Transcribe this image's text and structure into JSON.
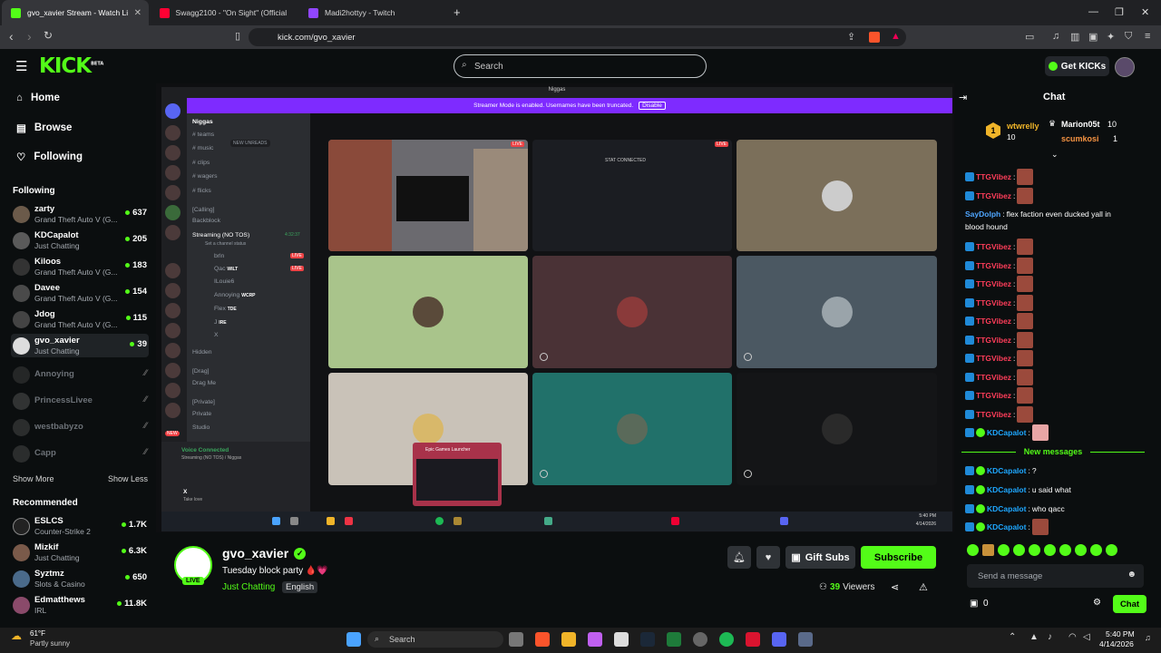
{
  "browser": {
    "tabs": [
      {
        "label": "gvo_xavier Stream - Watch Li",
        "color": "#53fc18",
        "active": true
      },
      {
        "label": "Swagg2100 - \"On Sight\" (Official Vide",
        "color": "#ff0033",
        "active": false
      },
      {
        "label": "Madi2hottyy - Twitch",
        "color": "#9146ff",
        "active": false
      }
    ],
    "new_tab": "+",
    "url": "kick.com/gvo_xavier"
  },
  "header": {
    "logo": "KICK",
    "logo_sup": "BETA",
    "search_placeholder": "Search",
    "get_kicks": "Get KICKs"
  },
  "sidebar": {
    "nav": [
      {
        "label": "Home",
        "icon": "home-icon"
      },
      {
        "label": "Browse",
        "icon": "browse-icon"
      },
      {
        "label": "Following",
        "icon": "heart-icon"
      }
    ],
    "following_title": "Following",
    "following": [
      {
        "name": "zarty",
        "sub": "Grand Theft Auto V (G...",
        "count": "637",
        "online": true
      },
      {
        "name": "KDCapalot",
        "sub": "Just Chatting",
        "count": "205",
        "online": true
      },
      {
        "name": "Kiloos",
        "sub": "Grand Theft Auto V (G...",
        "count": "183",
        "online": true
      },
      {
        "name": "Davee",
        "sub": "Grand Theft Auto V (G...",
        "count": "154",
        "online": true
      },
      {
        "name": "Jdog",
        "sub": "Grand Theft Auto V (G...",
        "count": "115",
        "online": true
      },
      {
        "name": "gvo_xavier",
        "sub": "Just Chatting",
        "count": "39",
        "online": true,
        "selected": true
      },
      {
        "name": "Annoying",
        "online": false
      },
      {
        "name": "PrincessLivee",
        "online": false
      },
      {
        "name": "westbabyzo",
        "online": false
      },
      {
        "name": "Capp",
        "online": false
      }
    ],
    "show_more": "Show More",
    "show_less": "Show Less",
    "recommended_title": "Recommended",
    "recommended": [
      {
        "name": "ESLCS",
        "sub": "Counter-Strike 2",
        "count": "1.7K"
      },
      {
        "name": "Mizkif",
        "sub": "Just Chatting",
        "count": "6.3K"
      },
      {
        "name": "Syztmz",
        "sub": "Slots & Casino",
        "count": "650"
      },
      {
        "name": "Edmatthews",
        "sub": "IRL",
        "count": "11.8K"
      }
    ]
  },
  "stream_content": {
    "window_title": "Niggas",
    "streamer_mode": "Streamer Mode is enabled. Usernames have been truncated.",
    "disable": "Disable",
    "server_name": "Niggas",
    "channels": [
      "teams",
      "music",
      "clips",
      "wagers",
      "flicks"
    ],
    "new_unreads": "NEW UNREADS",
    "calling_cat": "[Calling]",
    "backblock": "Backblock",
    "streaming_channel": "Streaming (NO TOS)",
    "streaming_time": "4:32:37",
    "set_status": "Set a channel status",
    "members": [
      {
        "name": "brln",
        "tag": "LIVE"
      },
      {
        "name": "Qac",
        "tag": "WILT"
      },
      {
        "name": "ILouie6",
        "tag": ""
      },
      {
        "name": "Annoying",
        "tag": "WCRP"
      },
      {
        "name": "Flex",
        "tag": "TDE"
      },
      {
        "name": "J",
        "tag": "IRE"
      },
      {
        "name": "X",
        "tag": ""
      }
    ],
    "hidden": "Hidden",
    "drag_cat": "[Drag]",
    "drag_me": "Drag Me",
    "private_cat": "[Private]",
    "private": "Private",
    "studio": "Studio",
    "voice_connected": "Voice Connected",
    "voice_sub": "Streaming (NO TOS) / Niggas",
    "user_x": "X",
    "user_status": "Take love",
    "popup": "Epic Games Launcher",
    "live_tag": "LIVE",
    "stream_title": "STAT CONNECTED",
    "time": "5:40 PM",
    "date": "4/14/2026",
    "new_badge": "NEW"
  },
  "channel": {
    "name": "gvo_xavier",
    "live": "LIVE",
    "title": "Tuesday block party 🩸💗",
    "category": "Just Chatting",
    "language": "English",
    "gift_subs": "Gift Subs",
    "subscribe": "Subscribe",
    "viewers_count": "39",
    "viewers_label": "Viewers"
  },
  "chat": {
    "title": "Chat",
    "leaderboard": [
      {
        "rank": "1",
        "name": "wtwrelly",
        "count": "10"
      },
      {
        "name": "Marion05t",
        "count": "10"
      },
      {
        "name": "scumkosi",
        "count": "1"
      }
    ],
    "messages": [
      {
        "user": "TTGVibez",
        "text": "",
        "style": "u1"
      },
      {
        "user": "TTGVibez",
        "text": "",
        "style": "u1"
      },
      {
        "user": "SayDolph",
        "text": "flex faction even ducked yall in",
        "text2": "blood hound",
        "style": "u3"
      },
      {
        "user": "TTGVibez",
        "style": "u1"
      },
      {
        "user": "TTGVibez",
        "style": "u1"
      },
      {
        "user": "TTGVibez",
        "style": "u1"
      },
      {
        "user": "TTGVibez",
        "style": "u1"
      },
      {
        "user": "TTGVibez",
        "style": "u1"
      },
      {
        "user": "TTGVibez",
        "style": "u1"
      },
      {
        "user": "TTGVibez",
        "style": "u1"
      },
      {
        "user": "TTGVibez",
        "style": "u1"
      },
      {
        "user": "TTGVibez",
        "style": "u1"
      },
      {
        "user": "TTGVibez",
        "style": "u1"
      },
      {
        "user": "KDCapalot",
        "style": "u2"
      }
    ],
    "new_messages": "New messages",
    "after": [
      {
        "user": "KDCapalot",
        "text": "?"
      },
      {
        "user": "KDCapalot",
        "text": "u said what"
      },
      {
        "user": "KDCapalot",
        "text": "who qacc"
      },
      {
        "user": "KDCapalot",
        "text": ""
      }
    ],
    "send_placeholder": "Send a message",
    "kicks_count": "0",
    "chat_button": "Chat"
  },
  "taskbar": {
    "weather_temp": "61°F",
    "weather_desc": "Partly sunny",
    "search": "Search",
    "time": "5:40 PM",
    "date": "4/14/2026"
  }
}
